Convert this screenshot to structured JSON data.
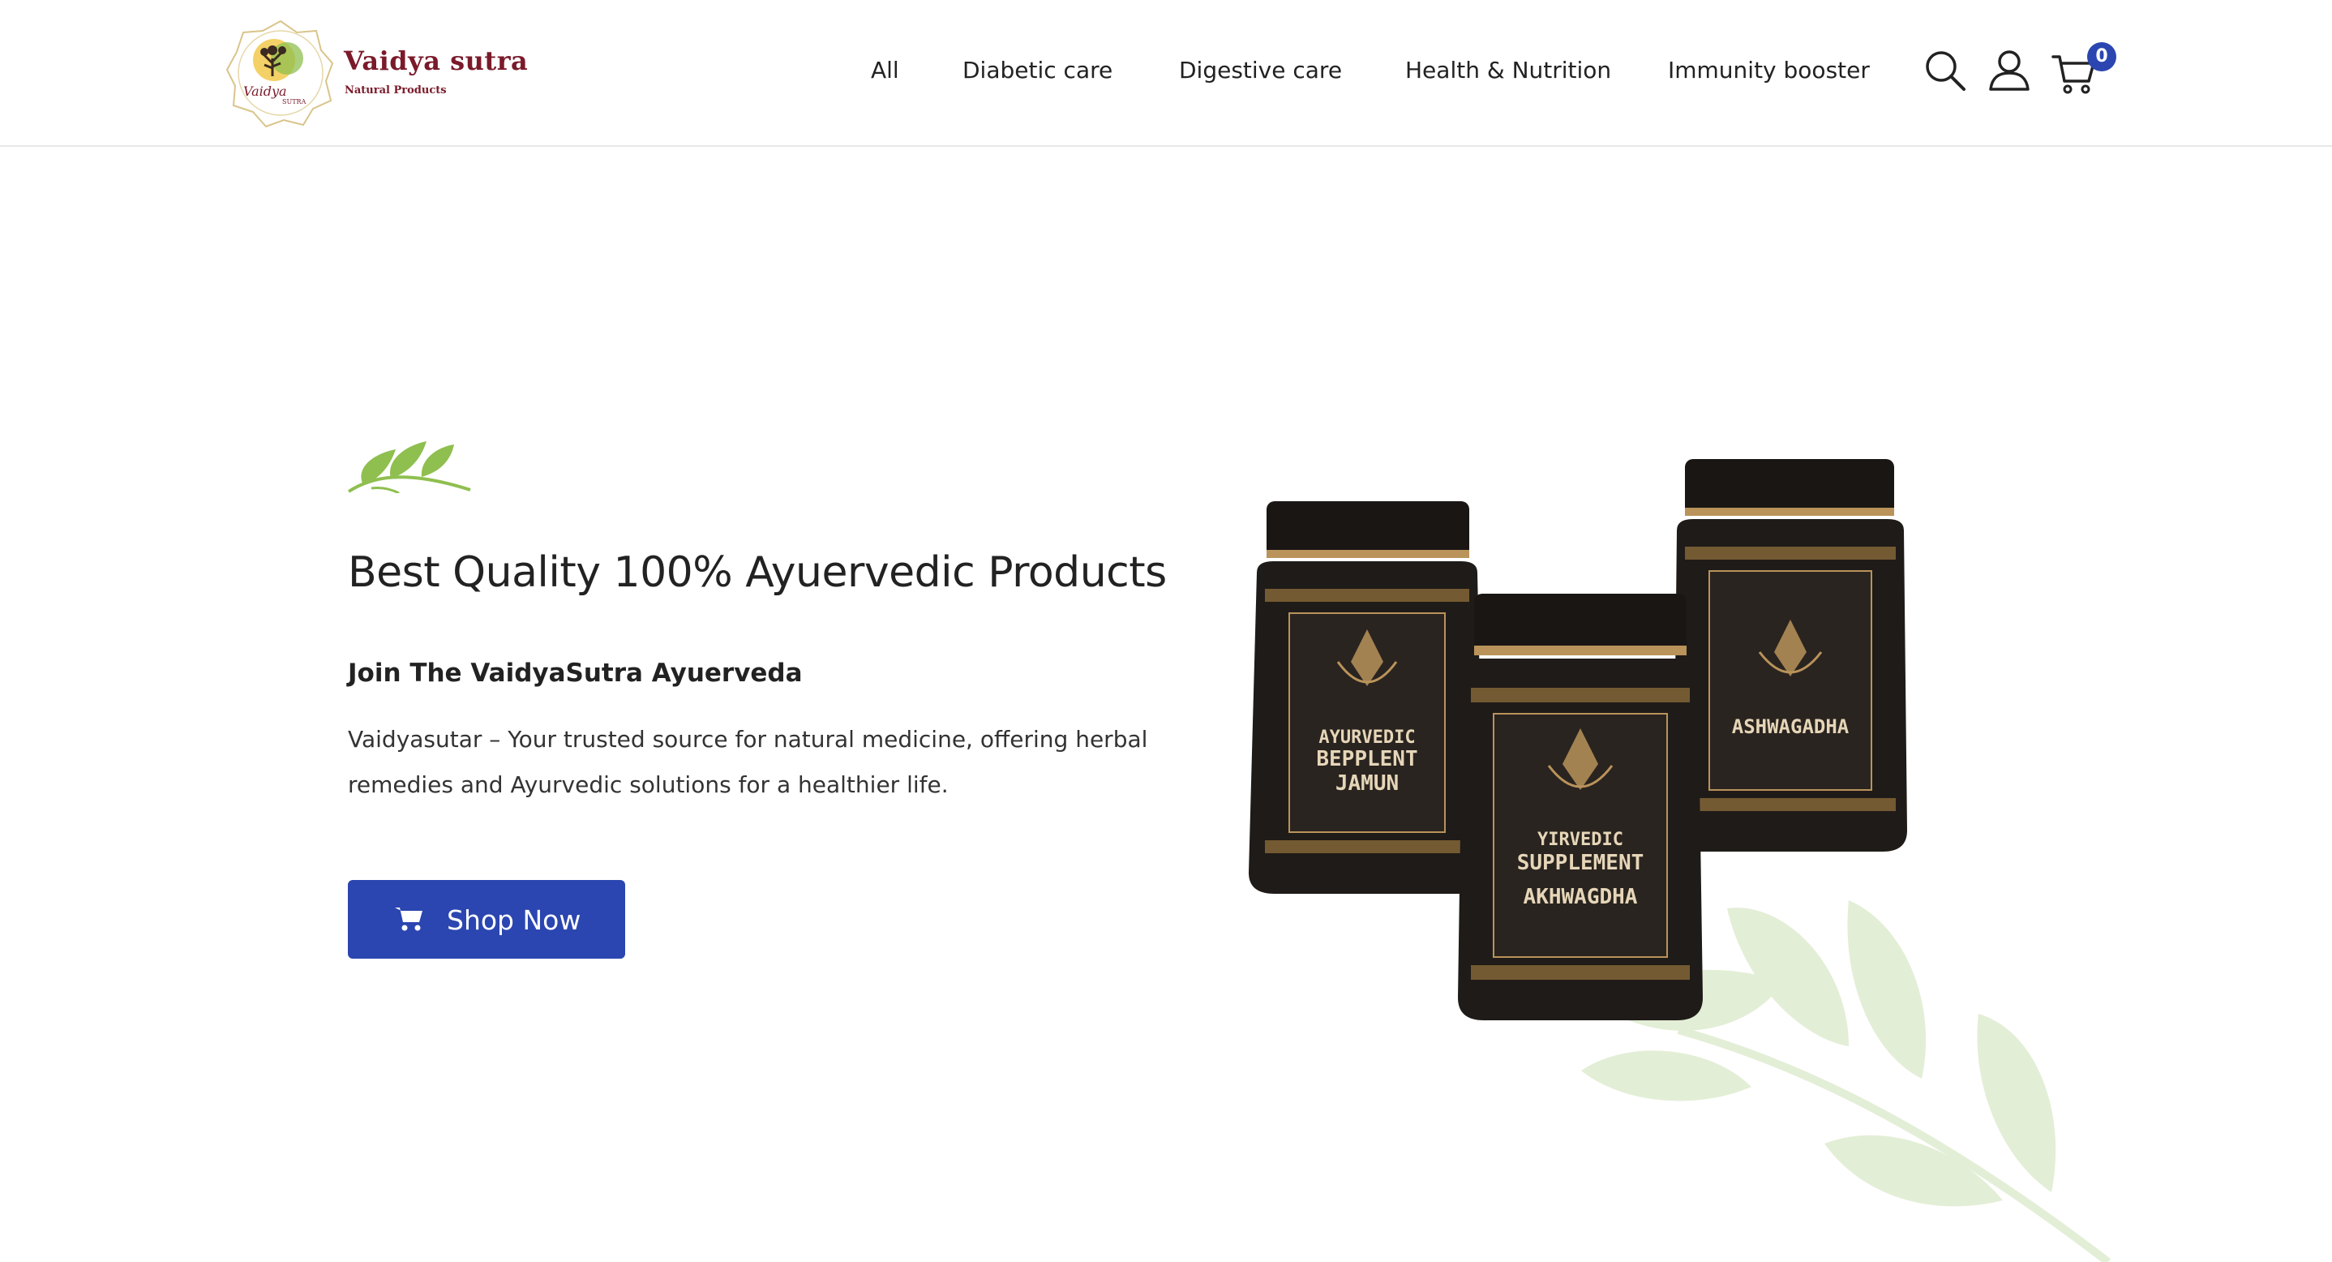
{
  "brand": {
    "name": "Vaidya sutra",
    "tagline": "Natural Products",
    "emblem_text": "Vaidya",
    "emblem_subtext": "SUTRA"
  },
  "nav": {
    "items": [
      {
        "label": "All"
      },
      {
        "label": "Diabetic care"
      },
      {
        "label": "Digestive care"
      },
      {
        "label": "Health & Nutrition"
      },
      {
        "label": "Immunity booster"
      }
    ]
  },
  "header_icons": {
    "search": "search-icon",
    "account": "user-icon",
    "cart": "cart-icon",
    "cart_count": "0"
  },
  "hero": {
    "title": "Best Quality 100% Ayuervedic Products",
    "subtitle": "Join The VaidyaSutra Ayuerveda",
    "description": "Vaidyasutar – Your trusted source for natural medicine, offering herbal remedies and Ayurvedic solutions for a healthier life.",
    "cta_label": "Shop Now",
    "cta_icon": "shopping-cart-icon"
  },
  "products": {
    "jar_left": {
      "line1": "AYURVEDIC",
      "line2": "BEPPLENT",
      "line3": "JAMUN"
    },
    "jar_center": {
      "line1": "YIRVEDIC",
      "line2": "SUPPLEMENT",
      "line3": "AKHWAGDHA"
    },
    "jar_right": {
      "line1": "ASHWAGADHA"
    }
  },
  "colors": {
    "accent": "#2b46b0",
    "brand": "#7a1a2a",
    "leaf": "#8fbf4f",
    "leaf_faint": "#e3eed6",
    "jar_body": "#1f1b18",
    "jar_gold": "#b9935a"
  }
}
